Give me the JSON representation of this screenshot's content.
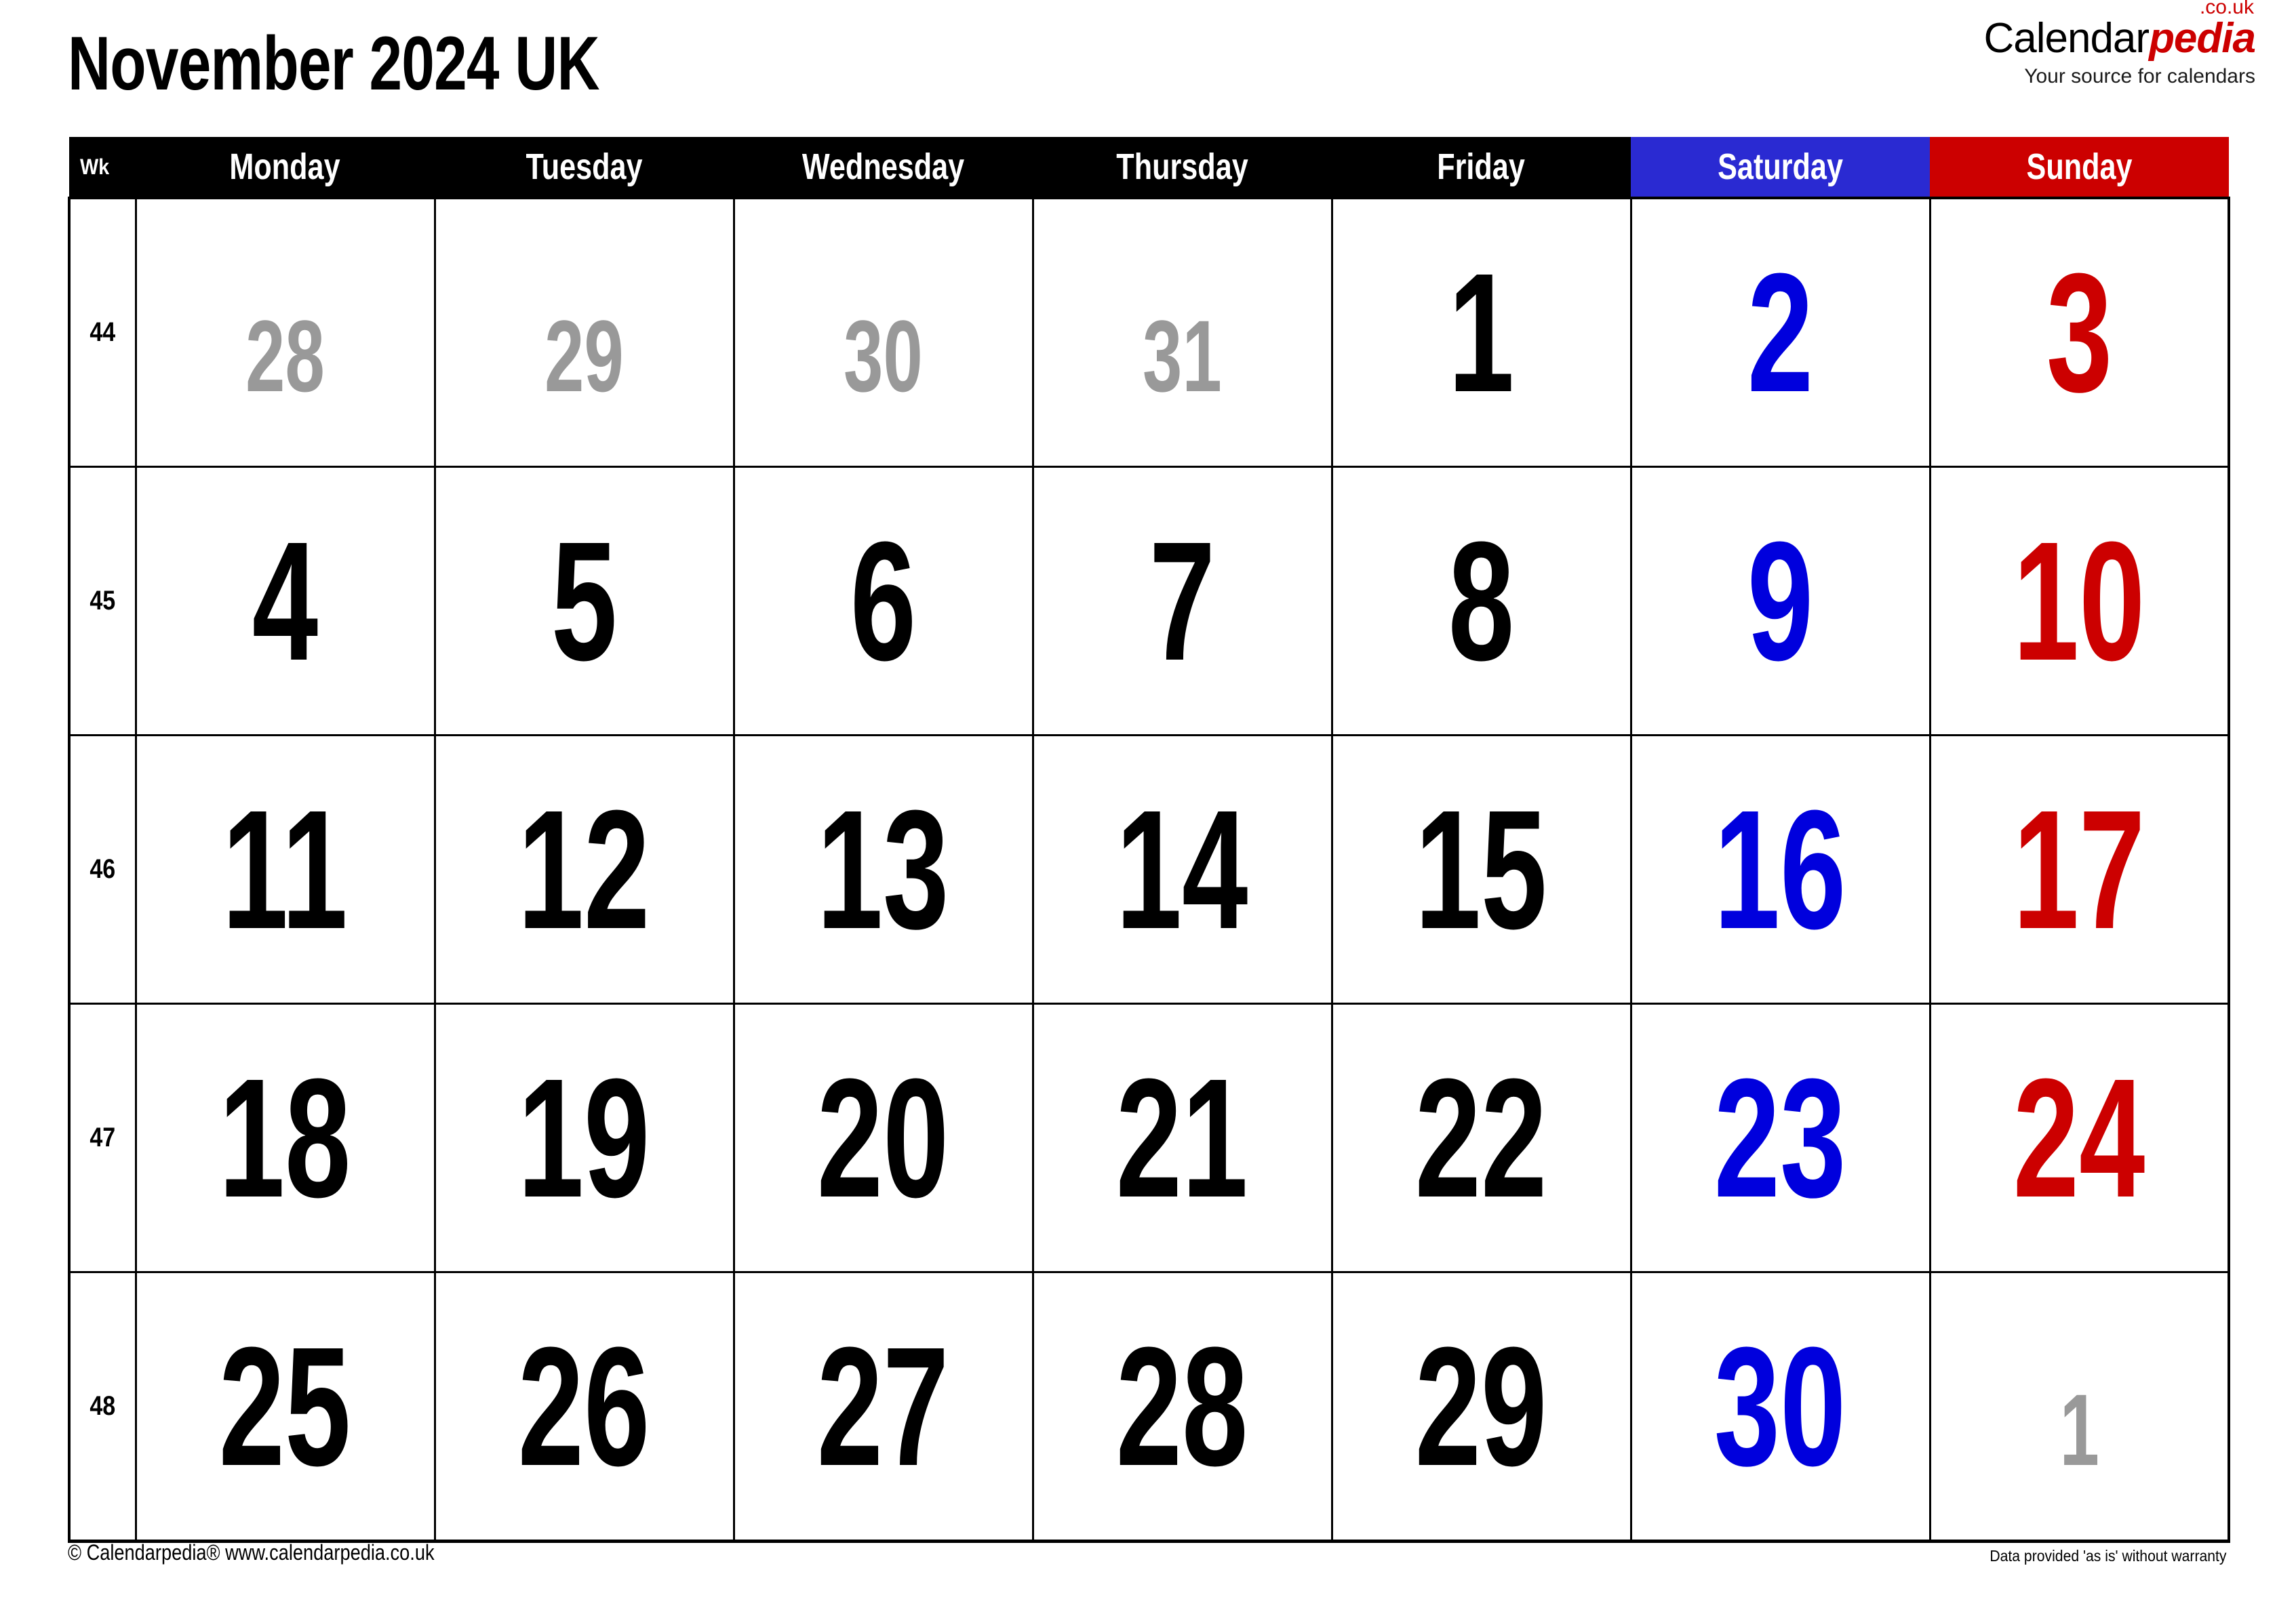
{
  "header": {
    "title": "November 2024 UK",
    "logo": {
      "name_part1": "Calendar",
      "name_part2": "pedia",
      "tld": ".co.uk",
      "tagline": "Your source for calendars",
      "accent_color": "#cc0000"
    }
  },
  "calendar": {
    "week_column_header": "Wk",
    "day_headers": [
      "Monday",
      "Tuesday",
      "Wednesday",
      "Thursday",
      "Friday",
      "Saturday",
      "Sunday"
    ],
    "header_colors": {
      "weekday": "#000000",
      "saturday": "#2a2ad2",
      "sunday": "#cc0000"
    },
    "day_colors": {
      "weekday": "#000000",
      "saturday": "#0000dd",
      "sunday": "#cc0000",
      "other_month": "#999999"
    },
    "weeks": [
      {
        "week_number": "44",
        "days": [
          {
            "label": "28",
            "type": "other"
          },
          {
            "label": "29",
            "type": "other"
          },
          {
            "label": "30",
            "type": "other"
          },
          {
            "label": "31",
            "type": "other"
          },
          {
            "label": "1",
            "type": "weekday"
          },
          {
            "label": "2",
            "type": "saturday"
          },
          {
            "label": "3",
            "type": "sunday"
          }
        ]
      },
      {
        "week_number": "45",
        "days": [
          {
            "label": "4",
            "type": "weekday"
          },
          {
            "label": "5",
            "type": "weekday"
          },
          {
            "label": "6",
            "type": "weekday"
          },
          {
            "label": "7",
            "type": "weekday"
          },
          {
            "label": "8",
            "type": "weekday"
          },
          {
            "label": "9",
            "type": "saturday"
          },
          {
            "label": "10",
            "type": "sunday"
          }
        ]
      },
      {
        "week_number": "46",
        "days": [
          {
            "label": "11",
            "type": "weekday"
          },
          {
            "label": "12",
            "type": "weekday"
          },
          {
            "label": "13",
            "type": "weekday"
          },
          {
            "label": "14",
            "type": "weekday"
          },
          {
            "label": "15",
            "type": "weekday"
          },
          {
            "label": "16",
            "type": "saturday"
          },
          {
            "label": "17",
            "type": "sunday"
          }
        ]
      },
      {
        "week_number": "47",
        "days": [
          {
            "label": "18",
            "type": "weekday"
          },
          {
            "label": "19",
            "type": "weekday"
          },
          {
            "label": "20",
            "type": "weekday"
          },
          {
            "label": "21",
            "type": "weekday"
          },
          {
            "label": "22",
            "type": "weekday"
          },
          {
            "label": "23",
            "type": "saturday"
          },
          {
            "label": "24",
            "type": "sunday"
          }
        ]
      },
      {
        "week_number": "48",
        "days": [
          {
            "label": "25",
            "type": "weekday"
          },
          {
            "label": "26",
            "type": "weekday"
          },
          {
            "label": "27",
            "type": "weekday"
          },
          {
            "label": "28",
            "type": "weekday"
          },
          {
            "label": "29",
            "type": "weekday"
          },
          {
            "label": "30",
            "type": "saturday"
          },
          {
            "label": "1",
            "type": "other"
          }
        ]
      }
    ]
  },
  "footer": {
    "copyright": "© Calendarpedia®   www.calendarpedia.co.uk",
    "disclaimer": "Data provided 'as is' without warranty"
  }
}
